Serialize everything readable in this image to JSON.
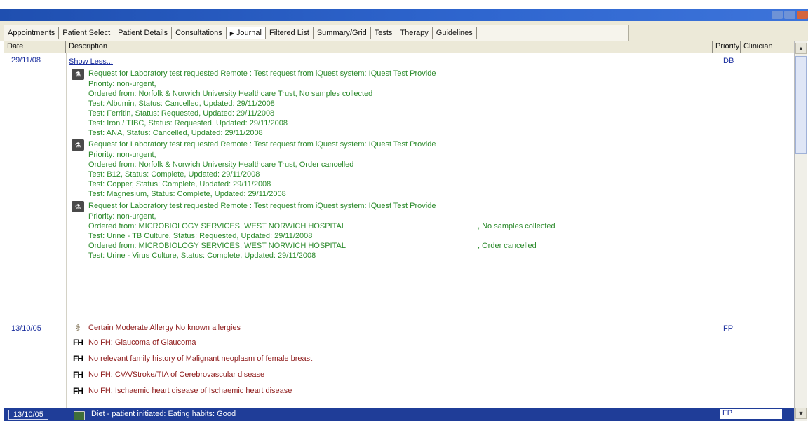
{
  "tabs": [
    {
      "label": "Appointments",
      "active": false
    },
    {
      "label": "Patient Select",
      "active": false
    },
    {
      "label": "Patient Details",
      "active": false
    },
    {
      "label": "Consultations",
      "active": false
    },
    {
      "label": "Journal",
      "active": true
    },
    {
      "label": "Filtered List",
      "active": false
    },
    {
      "label": "Summary/Grid",
      "active": false
    },
    {
      "label": "Tests",
      "active": false
    },
    {
      "label": "Therapy",
      "active": false
    },
    {
      "label": "Guidelines",
      "active": false
    }
  ],
  "columns": {
    "date": "Date",
    "description": "Description",
    "priority": "Priority",
    "clinician": "Clinician"
  },
  "entries": {
    "e1": {
      "date": "29/11/08",
      "clinician": "DB",
      "show_less": "Show Less...",
      "lab1": [
        "Request for Laboratory test requested Remote : Test request from iQuest system: IQuest Test Provide",
        "Priority: non-urgent,",
        "Ordered from: Norfolk & Norwich University Healthcare Trust, No samples collected",
        "Test: Albumin, Status: Cancelled, Updated: 29/11/2008",
        "Test: Ferritin, Status: Requested, Updated: 29/11/2008",
        "Test: Iron / TIBC, Status: Requested, Updated: 29/11/2008",
        "Test: ANA, Status: Cancelled, Updated: 29/11/2008"
      ],
      "lab2": [
        "Request for Laboratory test requested Remote : Test request from iQuest system: IQuest Test Provide",
        "Priority: non-urgent,",
        "Ordered from: Norfolk & Norwich University Healthcare Trust, Order cancelled",
        "Test: B12, Status: Complete, Updated: 29/11/2008",
        "Test: Copper, Status: Complete, Updated: 29/11/2008",
        "Test: Magnesium, Status: Complete, Updated: 29/11/2008"
      ],
      "lab3": [
        "Request for Laboratory test requested Remote : Test request from iQuest system: IQuest Test Provide",
        "Priority: non-urgent,",
        "Ordered from: MICROBIOLOGY SERVICES, WEST NORWICH HOSPITAL",
        "Test: Urine - TB Culture, Status: Requested, Updated: 29/11/2008",
        "Ordered from: MICROBIOLOGY SERVICES, WEST NORWICH HOSPITAL",
        "Test: Urine - Virus Culture, Status: Complete, Updated: 29/11/2008"
      ],
      "lab3_status": [
        ", No samples collected",
        ", Order cancelled"
      ]
    },
    "e2": {
      "date": "13/10/05",
      "clinician": "FP",
      "allergy": "Certain Moderate Allergy No known allergies",
      "fh_label": "FH",
      "fh": [
        "No FH: Glaucoma of Glaucoma",
        "No relevant family history of Malignant neoplasm of female breast",
        "No FH: CVA/Stroke/TIA of Cerebrovascular disease",
        "No FH: Ischaemic heart disease of Ischaemic heart disease"
      ]
    },
    "e3": {
      "date": "13/10/05",
      "clinician": "FP",
      "text": "Diet - patient initiated: Eating habits: Good"
    }
  },
  "scroll": {
    "up": "▲",
    "down": "▼"
  }
}
